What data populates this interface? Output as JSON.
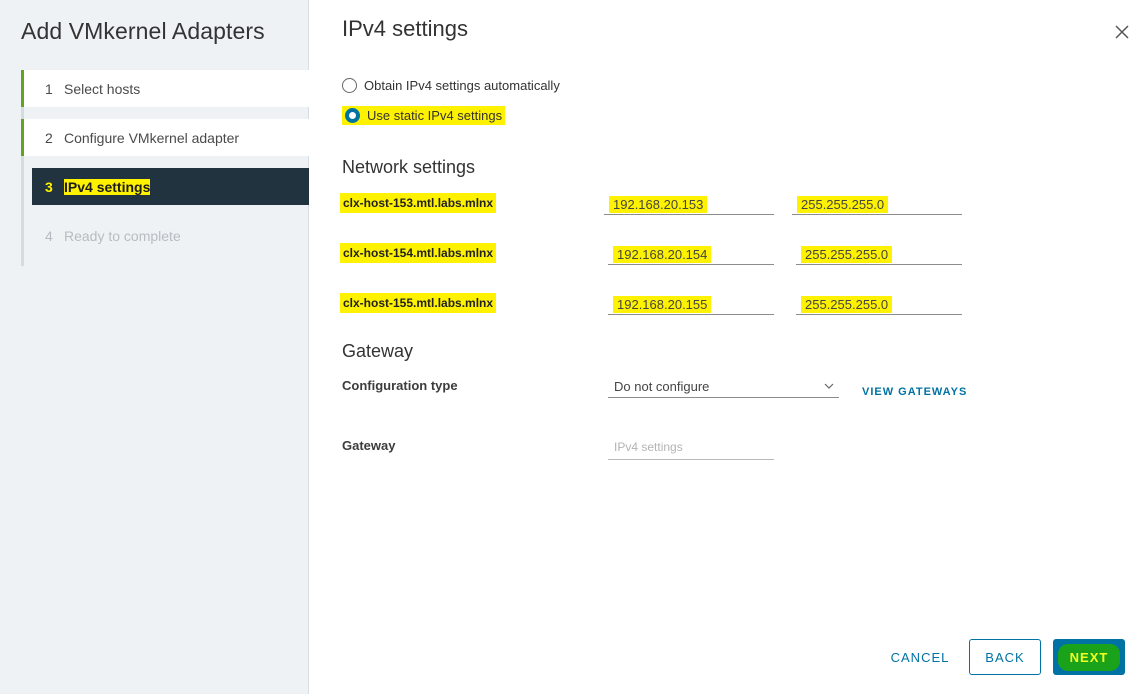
{
  "wizard": {
    "title": "Add VMkernel Adapters",
    "steps": [
      {
        "num": "1",
        "label": "Select hosts"
      },
      {
        "num": "2",
        "label": "Configure VMkernel adapter"
      },
      {
        "num": "3",
        "label": "IPv4 settings"
      },
      {
        "num": "4",
        "label": "Ready to complete"
      }
    ]
  },
  "page": {
    "title": "IPv4 settings",
    "radio_auto": "Obtain IPv4 settings automatically",
    "radio_static": "Use static IPv4 settings",
    "network_heading": "Network settings",
    "hosts": [
      {
        "name": "clx-host-153.mtl.labs.mlnx",
        "ip": "192.168.20.153",
        "mask": "255.255.255.0"
      },
      {
        "name": "clx-host-154.mtl.labs.mlnx",
        "ip": "192.168.20.154",
        "mask": "255.255.255.0"
      },
      {
        "name": "clx-host-155.mtl.labs.mlnx",
        "ip": "192.168.20.155",
        "mask": "255.255.255.0"
      }
    ],
    "gateway_heading": "Gateway",
    "config_type_label": "Configuration type",
    "config_type_value": "Do not configure",
    "view_gateways": "VIEW GATEWAYS",
    "gateway_label": "Gateway",
    "gateway_placeholder": "IPv4 settings"
  },
  "footer": {
    "cancel": "CANCEL",
    "back": "BACK",
    "next": "NEXT"
  }
}
